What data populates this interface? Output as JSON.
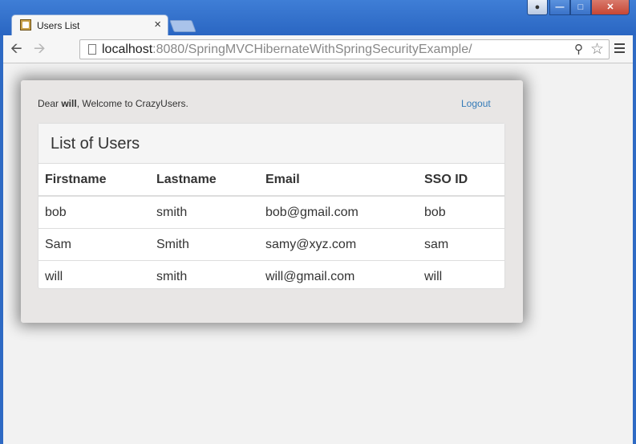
{
  "browser": {
    "tab_title": "Users List",
    "tab_close": "×",
    "url_host": "localhost",
    "url_rest": ":8080/SpringMVCHibernateWithSpringSecurityExample/"
  },
  "page": {
    "greeting_prefix": "Dear ",
    "user": "will",
    "greeting_suffix": ", Welcome to CrazyUsers.",
    "logout": "Logout",
    "panel_title": "List of Users",
    "table": {
      "headers": [
        "Firstname",
        "Lastname",
        "Email",
        "SSO ID"
      ],
      "rows": [
        [
          "bob",
          "smith",
          "bob@gmail.com",
          "bob"
        ],
        [
          "Sam",
          "Smith",
          "samy@xyz.com",
          "sam"
        ],
        [
          "will",
          "smith",
          "will@gmail.com",
          "will"
        ]
      ]
    }
  }
}
